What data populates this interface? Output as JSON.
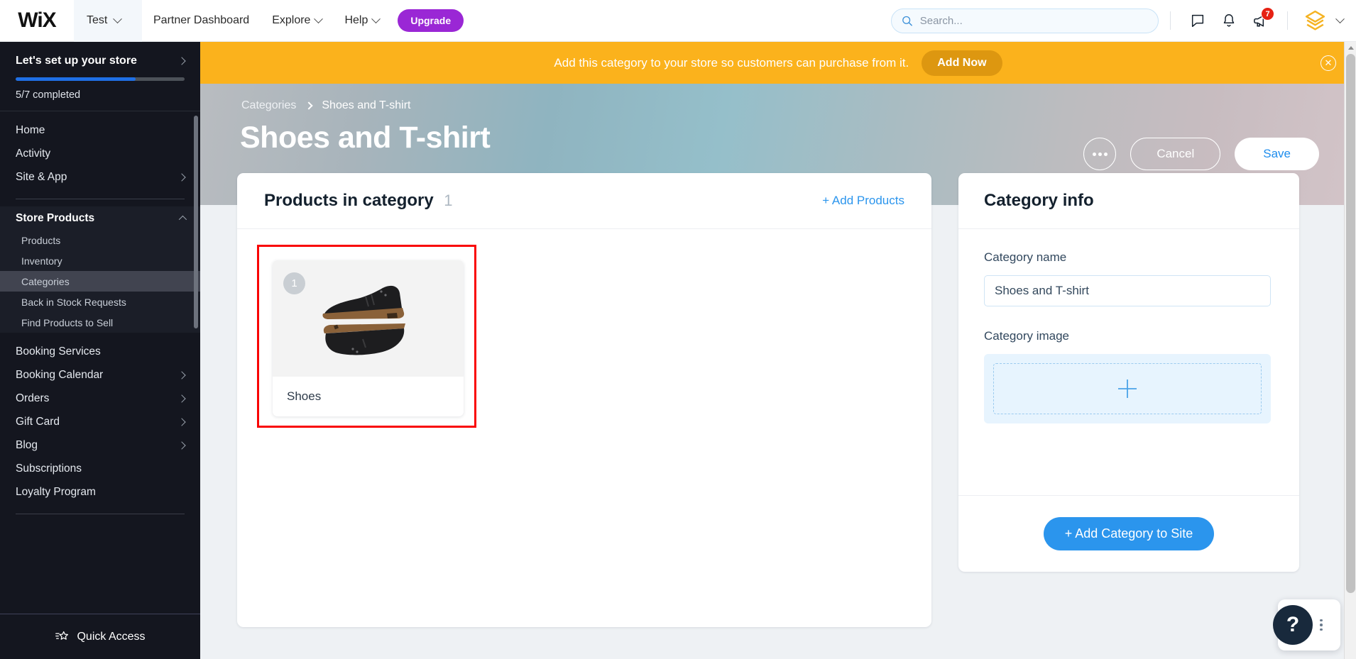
{
  "topbar": {
    "logo": "WiX",
    "site_selector": {
      "label": "Test",
      "icon": "chevron-down-icon"
    },
    "nav": [
      {
        "label": "Partner Dashboard",
        "caret": false
      },
      {
        "label": "Explore",
        "caret": true
      },
      {
        "label": "Help",
        "caret": true
      }
    ],
    "upgrade_label": "Upgrade",
    "search": {
      "value": "",
      "placeholder": "Search..."
    },
    "icons": [
      {
        "name": "chat-icon",
        "badge": ""
      },
      {
        "name": "bell-icon",
        "badge": ""
      },
      {
        "name": "megaphone-icon",
        "badge": "7"
      }
    ],
    "account_caret": "chevron-down-icon"
  },
  "sidebar": {
    "setup": {
      "title": "Let's set up your store",
      "progress_percent": 71,
      "status": "5/7 completed"
    },
    "items": [
      {
        "label": "Home",
        "caret": false,
        "indent": false,
        "active": false
      },
      {
        "label": "Activity",
        "caret": false,
        "indent": false,
        "active": false
      },
      {
        "label": "Site & App",
        "caret": true,
        "indent": false,
        "active": false
      }
    ],
    "section": {
      "label": "Store Products",
      "expanded": true,
      "children": [
        {
          "label": "Products",
          "active": false
        },
        {
          "label": "Inventory",
          "active": false
        },
        {
          "label": "Categories",
          "active": true
        },
        {
          "label": "Back in Stock Requests",
          "active": false
        },
        {
          "label": "Find Products to Sell",
          "active": false
        }
      ]
    },
    "items_after": [
      {
        "label": "Booking Services",
        "caret": false
      },
      {
        "label": "Booking Calendar",
        "caret": true
      },
      {
        "label": "Orders",
        "caret": true
      },
      {
        "label": "Gift Card",
        "caret": true
      },
      {
        "label": "Blog",
        "caret": true
      },
      {
        "label": "Subscriptions",
        "caret": false
      },
      {
        "label": "Loyalty Program",
        "caret": false
      }
    ],
    "quick_access": {
      "label": "Quick Access",
      "icon": "shooting-star-icon"
    }
  },
  "banner": {
    "text": "Add this category to your store so customers can purchase from it.",
    "action_label": "Add Now",
    "close_icon": "close-icon",
    "color": "#fbb21c"
  },
  "hero": {
    "breadcrumb": {
      "parent": "Categories",
      "current": "Shoes and T-shirt"
    },
    "title": "Shoes and T-shirt",
    "more_icon": "ellipsis-icon",
    "cancel_label": "Cancel",
    "save_label": "Save",
    "save_color": "#1e8ded"
  },
  "products_panel": {
    "title": "Products in category",
    "count": "1",
    "add_label": "+ Add Products",
    "highlight_color": "#f90505",
    "products": [
      {
        "badge": "1",
        "name": "Shoes",
        "image": "black-chukka-boots"
      }
    ]
  },
  "category_panel": {
    "title": "Category info",
    "name_label": "Category name",
    "name_value": "Shoes and T-shirt",
    "name_placeholder": "Category name",
    "image_label": "Category image",
    "image_upload_icon": "plus-icon",
    "add_to_site_label": "+ Add Category to Site",
    "accent_color": "#2b95ed"
  },
  "help_widget": {
    "icon": "question-mark-icon",
    "menu_icon": "vertical-dots-icon"
  }
}
